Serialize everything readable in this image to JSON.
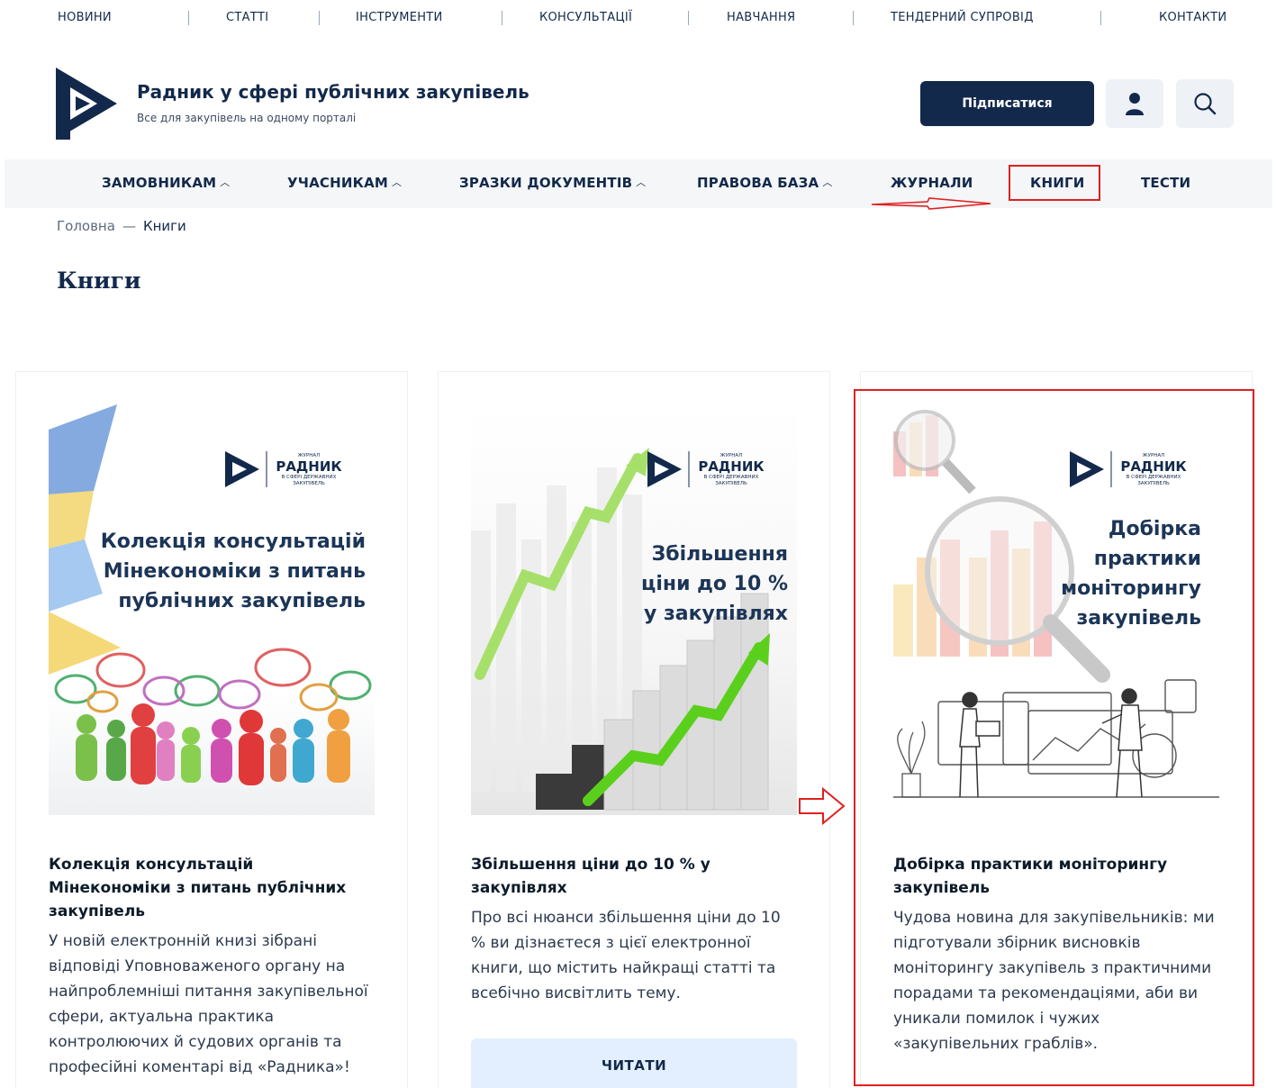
{
  "topnav": [
    "НОВИНИ",
    "СТАТТІ",
    "ІНСТРУМЕНТИ",
    "КОНСУЛЬТАЦІЇ",
    "НАВЧАННЯ",
    "ТЕНДЕРНИЙ СУПРОВІД",
    "КОНТАКТИ"
  ],
  "brand": {
    "title": "Радник у сфері публічних закупівель",
    "subtitle": "Все для закупівель на одному порталі"
  },
  "header": {
    "subscribe_label": "Підписатися"
  },
  "mainnav": [
    "ЗАМОВНИКАМ",
    "УЧАСНИКАМ",
    "ЗРАЗКИ ДОКУМЕНТІВ",
    "ПРАВОВА БАЗА",
    "ЖУРНАЛИ",
    "КНИГИ",
    "ТЕСТИ"
  ],
  "breadcrumb": {
    "home": "Головна",
    "separator": "—",
    "current": "Книги"
  },
  "page_title": "Книги",
  "cover_logo": {
    "small": "ЖУРНАЛ",
    "name": "РАДНИК",
    "sub1": "В СФЕРІ ДЕРЖАВНИХ",
    "sub2": "ЗАКУПІВЕЛЬ"
  },
  "cards": [
    {
      "cover_lines": [
        "Колекція консультацій",
        "Мінекономіки з питань",
        "публічних закупівель"
      ],
      "title": "Колекція консультацій Мінекономіки з питань публічних закупівель",
      "text": "У новій електронній книзі зібрані відповіді Уповноваженого органу на найпроблемніші питання закупівельної сфери, актуальна практика контролюючих й судових органів та професійні коментарі від «Радника»!"
    },
    {
      "cover_lines": [
        "Збільшення",
        "ціни до 10 %",
        "у закупівлях"
      ],
      "title": "Збільшення ціни до 10 % у закупівлях",
      "text": "Про всі нюанси збільшення ціни до 10 % ви дізнаєтеся з цієї електронної книги, що містить найкращі статті та всебічно висвітлить тему.",
      "button": "ЧИТАТИ"
    },
    {
      "cover_lines": [
        "Добірка",
        "практики",
        "моніторингу",
        "закупівель"
      ],
      "title": "Добірка практики моніторингу закупівель",
      "text": "Чудова новина для закупівельників: ми підготували збірник висновків моніторингу закупівель з практичними порадами та рекомендаціями, аби ви уникали помилок і чужих «закупівельних граблів»."
    }
  ],
  "colors": {
    "navy": "#13294b",
    "annotation": "#e02020",
    "button_light": "#e3efff"
  }
}
